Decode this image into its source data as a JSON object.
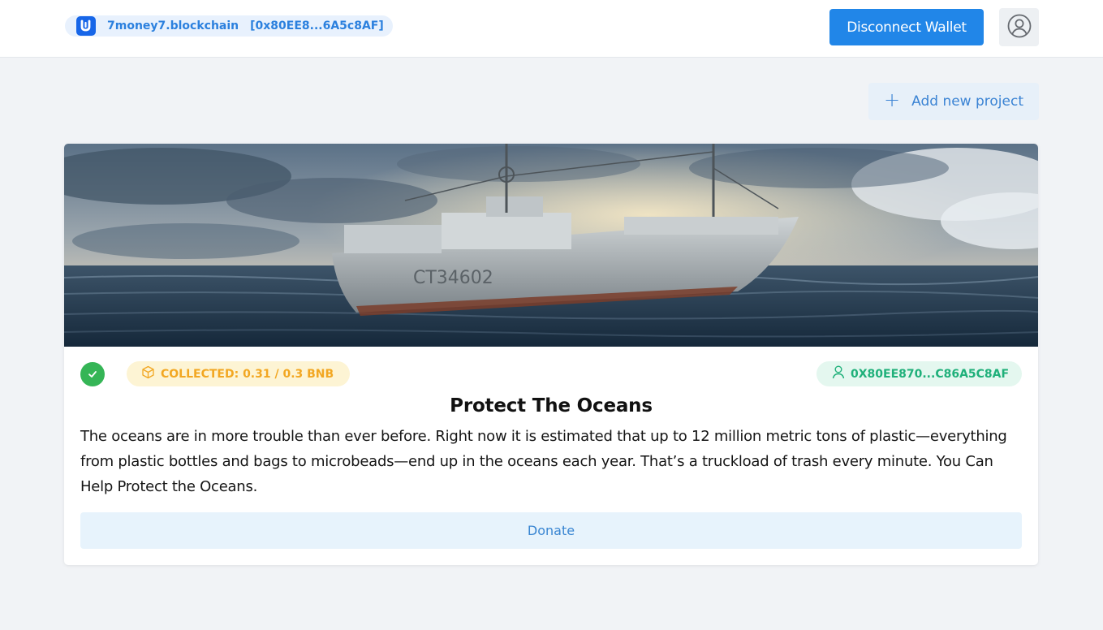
{
  "header": {
    "account_name": "7money7.blockchain",
    "account_address": "[0x80EE8...6A5c8AF]",
    "disconnect_label": "Disconnect Wallet",
    "profile_icon": "user-circle-icon",
    "logo_icon": "wallet-logo-icon"
  },
  "toolbar": {
    "add_project_label": "Add new project",
    "add_icon": "plus-icon"
  },
  "project": {
    "image_description_icon": "project-image",
    "status_icon": "check-circle-icon",
    "collected_label": "COLLECTED: 0.31 / 0.3 BNB",
    "collected_icon": "cube-icon",
    "owner_address": "0X80EE870...C86A5C8AF",
    "owner_icon": "user-icon",
    "title": "Protect The Oceans",
    "description": "The oceans are in more trouble than ever before. Right now it is estimated that up to 12 million metric tons of plastic—everything from plastic bottles and bags to microbeads—end up in the oceans each year. That’s a truckload of trash every minute. You Can Help Protect the Oceans.",
    "donate_label": "Donate"
  },
  "colors": {
    "primary": "#2186e8",
    "background": "#f1f3f6",
    "success": "#35b556",
    "collected_text": "#f2a722",
    "collected_bg": "#fdf4d4",
    "owner_text": "#1fb07a",
    "owner_bg": "#e4f7ef"
  }
}
